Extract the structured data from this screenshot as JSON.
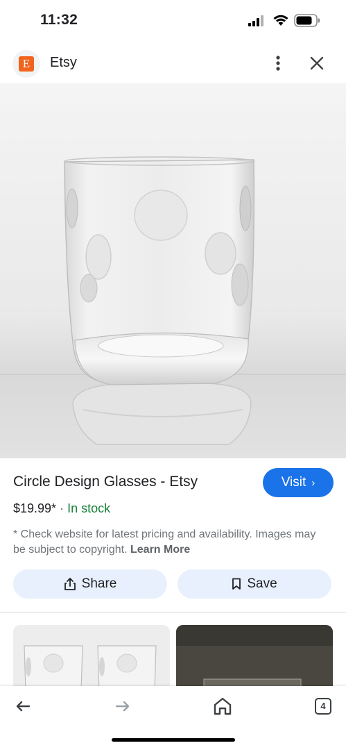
{
  "status_bar": {
    "time": "11:32",
    "icons": [
      "cellular-signal-icon",
      "wifi-icon",
      "battery-icon"
    ]
  },
  "header": {
    "logo_letter": "E",
    "site_name": "Etsy",
    "logo_color": "#f1641e",
    "icons": [
      "more-vert-icon",
      "close-icon"
    ]
  },
  "image": {
    "icon": "drinking-glass-photo"
  },
  "product": {
    "title": "Circle Design Glasses - Etsy",
    "visit_label": "Visit",
    "visit_chevron": "›",
    "price": "$19.99*",
    "separator": "·",
    "stock": "In stock",
    "disclaimer": "* Check website for latest pricing and availability. Images may be subject to copyright.",
    "learn_more": "Learn More",
    "accent_color": "#1a73e8",
    "stock_color": "#188038"
  },
  "actions": {
    "share_label": "Share",
    "save_label": "Save",
    "icons": [
      "share-icon",
      "bookmark-icon"
    ]
  },
  "related": {
    "thumbnails": [
      "related-glasses-photo",
      "related-glass-dark-photo"
    ]
  },
  "bottom_nav": {
    "tab_count": "4",
    "icons": [
      "back-arrow-icon",
      "forward-arrow-icon",
      "home-icon",
      "tabs-icon"
    ]
  }
}
